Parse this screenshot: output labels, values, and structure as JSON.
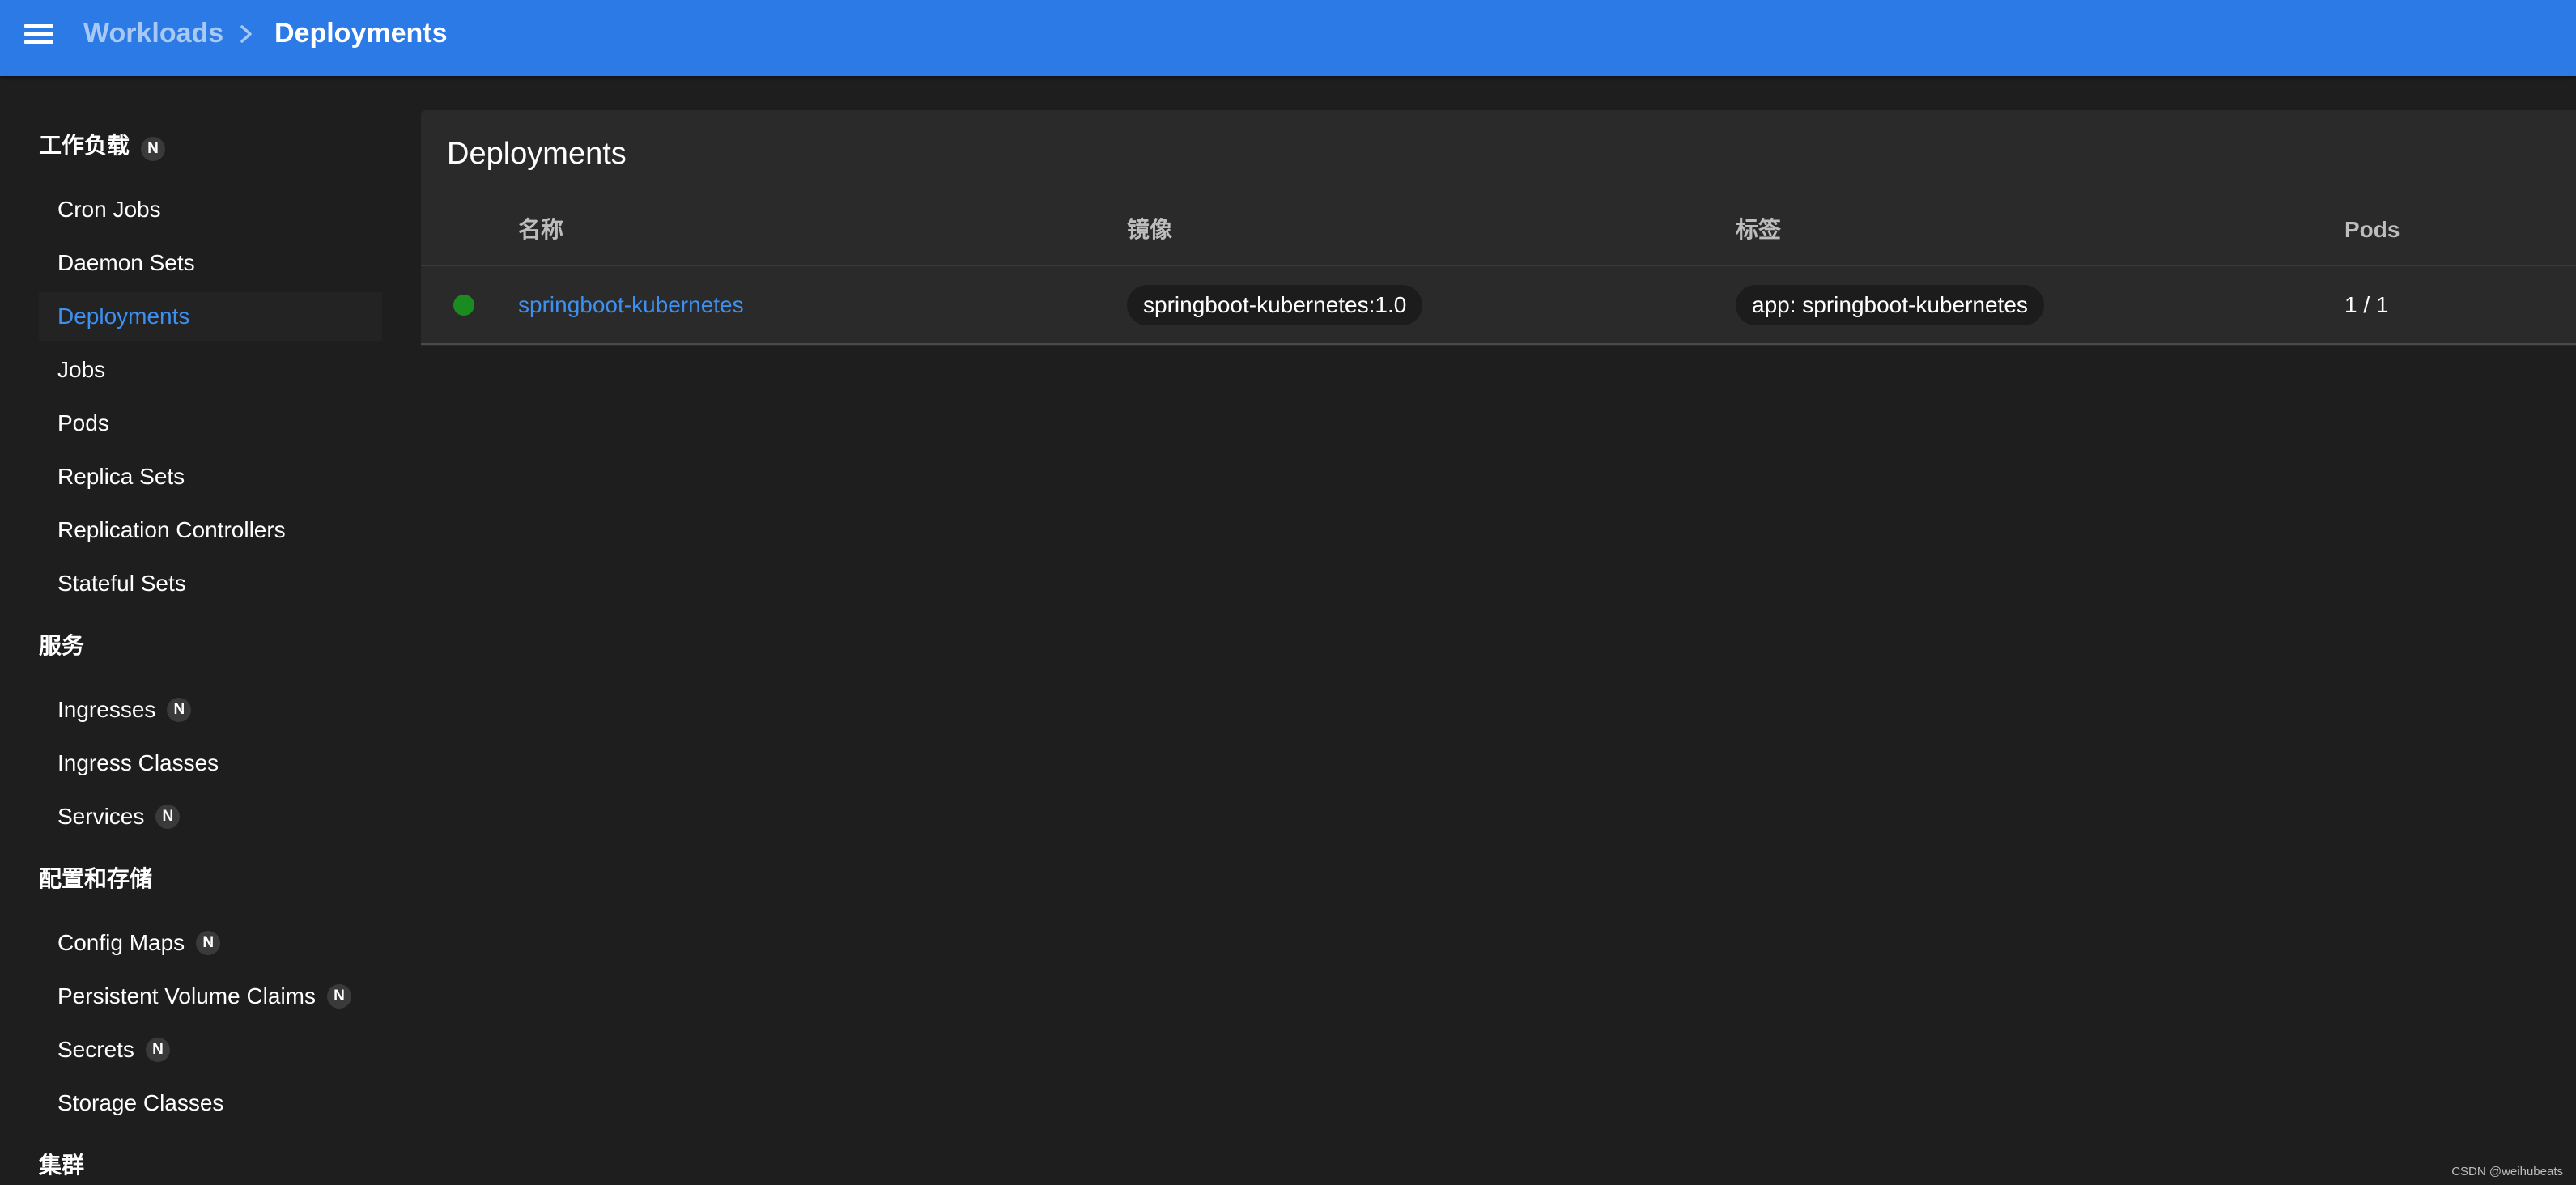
{
  "breadcrumb": {
    "parent": "Workloads",
    "current": "Deployments"
  },
  "sidebar": {
    "sections": [
      {
        "title": "工作负载",
        "badge": "N",
        "items": [
          {
            "label": "Cron Jobs"
          },
          {
            "label": "Daemon Sets"
          },
          {
            "label": "Deployments",
            "active": true
          },
          {
            "label": "Jobs"
          },
          {
            "label": "Pods"
          },
          {
            "label": "Replica Sets"
          },
          {
            "label": "Replication Controllers"
          },
          {
            "label": "Stateful Sets"
          }
        ]
      },
      {
        "title": "服务",
        "items": [
          {
            "label": "Ingresses",
            "badge": "N"
          },
          {
            "label": "Ingress Classes"
          },
          {
            "label": "Services",
            "badge": "N"
          }
        ]
      },
      {
        "title": "配置和存储",
        "items": [
          {
            "label": "Config Maps",
            "badge": "N"
          },
          {
            "label": "Persistent Volume Claims",
            "badge": "N"
          },
          {
            "label": "Secrets",
            "badge": "N"
          },
          {
            "label": "Storage Classes"
          }
        ]
      },
      {
        "title": "集群"
      }
    ]
  },
  "main": {
    "card_title": "Deployments",
    "columns": [
      "名称",
      "镜像",
      "标签",
      "Pods"
    ],
    "rows": [
      {
        "status": "running",
        "name": "springboot-kubernetes",
        "image": "springboot-kubernetes:1.0",
        "label": "app: springboot-kubernetes",
        "pods": "1 / 1"
      }
    ]
  },
  "colors": {
    "topbar": "#2b7ae5",
    "accent": "#3d8ff0",
    "status_ok": "#1a8c1f",
    "background": "#1e1e1e",
    "card": "#2a2a2a"
  },
  "watermark": "CSDN @weihubeats"
}
